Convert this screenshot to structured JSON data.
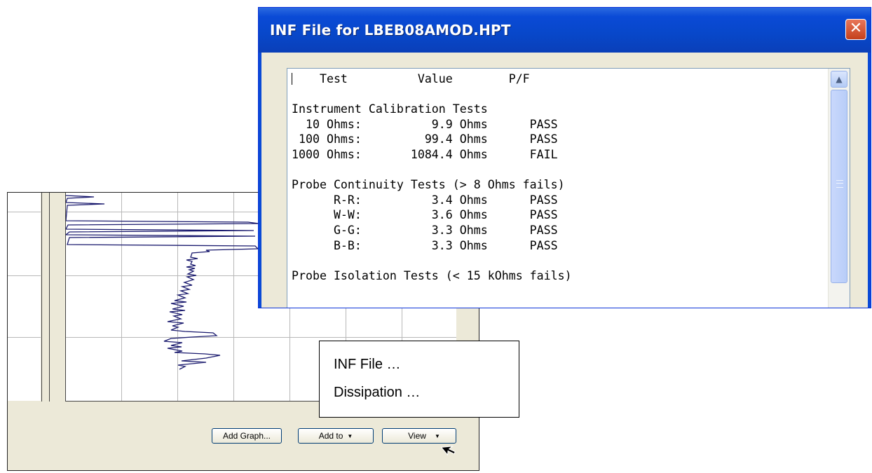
{
  "dialog": {
    "title": "INF File for LBEB08AMOD.HPT",
    "close_glyph": "✕",
    "report_text": "    Test          Value        P/F\n\nInstrument Calibration Tests\n  10 Ohms:          9.9 Ohms      PASS\n 100 Ohms:         99.4 Ohms      PASS\n1000 Ohms:       1084.4 Ohms      FAIL\n\nProbe Continuity Tests (> 8 Ohms fails)\n      R-R:          3.4 Ohms      PASS\n      W-W:          3.6 Ohms      PASS\n      G-G:          3.3 Ohms      PASS\n      B-B:          3.3 Ohms      PASS\n\nProbe Isolation Tests (< 15 kOhms fails)"
  },
  "toolbar": {
    "add_graph_label": "Add Graph...",
    "add_to_label": "Add to",
    "view_label": "View",
    "dropdown_glyph": "▼"
  },
  "context_menu": {
    "items": [
      "INF File …",
      "Dissipation …"
    ]
  },
  "icons": {
    "close": "close-icon",
    "scroll_up": "chevron-up-icon",
    "dropdown": "triangle-down-icon",
    "cursor": "mouse-pointer-icon"
  },
  "colors": {
    "titlebar": "#0a4ad6",
    "close_button": "#d5532f",
    "trace": "#1a1a6e",
    "window_bg": "#ece9d8"
  }
}
